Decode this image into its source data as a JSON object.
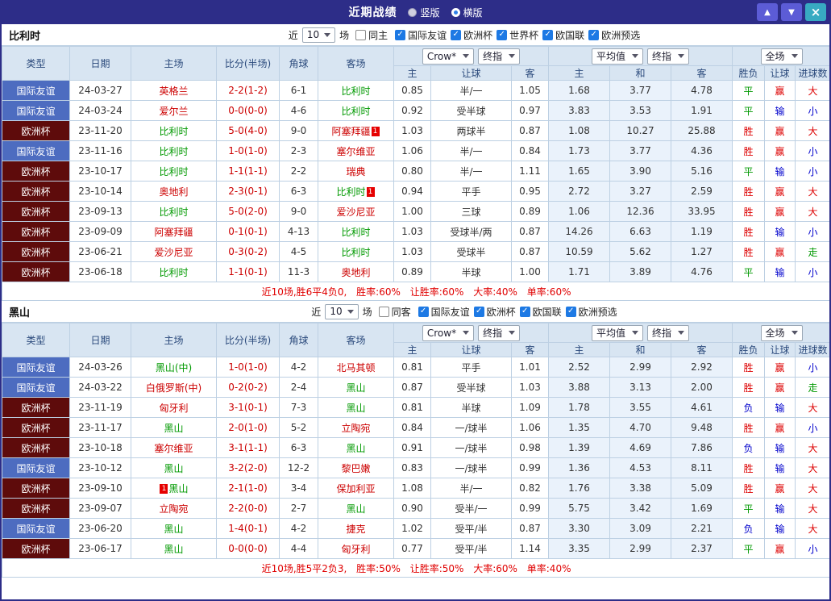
{
  "topbar": {
    "title": "近期战绩",
    "layout_options": [
      {
        "label": "竖版",
        "selected": false
      },
      {
        "label": "横版",
        "selected": true
      }
    ],
    "buttons": {
      "up": "▲",
      "down": "▼",
      "close": "×"
    }
  },
  "filter_common": {
    "near": "近",
    "count": "10",
    "matches": "场"
  },
  "table_header": {
    "static_cols": [
      "类型",
      "日期",
      "主场",
      "比分(半场)",
      "角球",
      "客场"
    ],
    "bookmaker_select": "Crow*",
    "stage_select": "终指",
    "average_select": "平均值",
    "avg_stage_select": "终指",
    "scope_select": "全场",
    "bookmaker_sub": [
      "主",
      "让球",
      "客"
    ],
    "average_sub": [
      "主",
      "和",
      "客"
    ],
    "result_sub": [
      "胜负",
      "让球",
      "进球数"
    ]
  },
  "colors": {
    "topbar_bg": "#2d2d88",
    "frame_border": "#2d2d88",
    "nav_btn_bg": "#5c5cd6",
    "close_btn_bg": "#38aac2",
    "header_bg": "#d8e5f2",
    "header_text": "#2b4a7c",
    "border": "#bdd0e3",
    "avg_col_bg": "#eaf2fb",
    "type_friendly_bg": "#4d6cc0",
    "type_euro_bg": "#5e0b0b",
    "subject_team": "#009900",
    "opponent_team": "#cc0000",
    "score_red": "#cc0000",
    "result_win": "#dd0000",
    "result_draw": "#009900",
    "result_lose": "#0000cc",
    "summary_red": "#e00000",
    "checkbox_blue": "#1d79e4",
    "radio_blue": "#2f7fe8"
  },
  "sections": [
    {
      "team": "比利时",
      "venue_filter": {
        "label": "同主",
        "checked": false
      },
      "competitions": [
        {
          "label": "国际友谊",
          "checked": true
        },
        {
          "label": "欧洲杯",
          "checked": true
        },
        {
          "label": "世界杯",
          "checked": true
        },
        {
          "label": "欧国联",
          "checked": true
        },
        {
          "label": "欧洲预选",
          "checked": true
        }
      ],
      "rows": [
        {
          "type": "国际友谊",
          "date": "24-03-27",
          "home": {
            "name": "英格兰",
            "subject": false
          },
          "score": "2-2(1-2)",
          "corners": "6-1",
          "away": {
            "name": "比利时",
            "subject": true
          },
          "odds": [
            "0.85",
            "半/一",
            "1.05"
          ],
          "avg": [
            "1.68",
            "3.77",
            "4.78"
          ],
          "results": [
            "平",
            "赢",
            "大"
          ]
        },
        {
          "type": "国际友谊",
          "date": "24-03-24",
          "home": {
            "name": "爱尔兰",
            "subject": false
          },
          "score": "0-0(0-0)",
          "corners": "4-6",
          "away": {
            "name": "比利时",
            "subject": true
          },
          "odds": [
            "0.92",
            "受半球",
            "0.97"
          ],
          "avg": [
            "3.83",
            "3.53",
            "1.91"
          ],
          "results": [
            "平",
            "输",
            "小"
          ]
        },
        {
          "type": "欧洲杯",
          "date": "23-11-20",
          "home": {
            "name": "比利时",
            "subject": true
          },
          "score": "5-0(4-0)",
          "corners": "9-0",
          "away": {
            "name": "阿塞拜疆",
            "subject": false,
            "card": "1",
            "card_pos": "after"
          },
          "odds": [
            "1.03",
            "两球半",
            "0.87"
          ],
          "avg": [
            "1.08",
            "10.27",
            "25.88"
          ],
          "results": [
            "胜",
            "赢",
            "大"
          ]
        },
        {
          "type": "国际友谊",
          "date": "23-11-16",
          "home": {
            "name": "比利时",
            "subject": true
          },
          "score": "1-0(1-0)",
          "corners": "2-3",
          "away": {
            "name": "塞尔维亚",
            "subject": false
          },
          "odds": [
            "1.06",
            "半/一",
            "0.84"
          ],
          "avg": [
            "1.73",
            "3.77",
            "4.36"
          ],
          "results": [
            "胜",
            "赢",
            "小"
          ]
        },
        {
          "type": "欧洲杯",
          "date": "23-10-17",
          "home": {
            "name": "比利时",
            "subject": true
          },
          "score": "1-1(1-1)",
          "corners": "2-2",
          "away": {
            "name": "瑞典",
            "subject": false
          },
          "odds": [
            "0.80",
            "半/一",
            "1.11"
          ],
          "avg": [
            "1.65",
            "3.90",
            "5.16"
          ],
          "results": [
            "平",
            "输",
            "小"
          ]
        },
        {
          "type": "欧洲杯",
          "date": "23-10-14",
          "home": {
            "name": "奥地利",
            "subject": false
          },
          "score": "2-3(0-1)",
          "corners": "6-3",
          "away": {
            "name": "比利时",
            "subject": true,
            "card": "1",
            "card_pos": "after"
          },
          "odds": [
            "0.94",
            "平手",
            "0.95"
          ],
          "avg": [
            "2.72",
            "3.27",
            "2.59"
          ],
          "results": [
            "胜",
            "赢",
            "大"
          ]
        },
        {
          "type": "欧洲杯",
          "date": "23-09-13",
          "home": {
            "name": "比利时",
            "subject": true
          },
          "score": "5-0(2-0)",
          "corners": "9-0",
          "away": {
            "name": "爱沙尼亚",
            "subject": false
          },
          "odds": [
            "1.00",
            "三球",
            "0.89"
          ],
          "avg": [
            "1.06",
            "12.36",
            "33.95"
          ],
          "results": [
            "胜",
            "赢",
            "大"
          ]
        },
        {
          "type": "欧洲杯",
          "date": "23-09-09",
          "home": {
            "name": "阿塞拜疆",
            "subject": false
          },
          "score": "0-1(0-1)",
          "corners": "4-13",
          "away": {
            "name": "比利时",
            "subject": true
          },
          "odds": [
            "1.03",
            "受球半/两",
            "0.87"
          ],
          "avg": [
            "14.26",
            "6.63",
            "1.19"
          ],
          "results": [
            "胜",
            "输",
            "小"
          ]
        },
        {
          "type": "欧洲杯",
          "date": "23-06-21",
          "home": {
            "name": "爱沙尼亚",
            "subject": false
          },
          "score": "0-3(0-2)",
          "corners": "4-5",
          "away": {
            "name": "比利时",
            "subject": true
          },
          "odds": [
            "1.03",
            "受球半",
            "0.87"
          ],
          "avg": [
            "10.59",
            "5.62",
            "1.27"
          ],
          "results": [
            "胜",
            "赢",
            "走"
          ]
        },
        {
          "type": "欧洲杯",
          "date": "23-06-18",
          "home": {
            "name": "比利时",
            "subject": true
          },
          "score": "1-1(0-1)",
          "corners": "11-3",
          "away": {
            "name": "奥地利",
            "subject": false
          },
          "odds": [
            "0.89",
            "半球",
            "1.00"
          ],
          "avg": [
            "1.71",
            "3.89",
            "4.76"
          ],
          "results": [
            "平",
            "输",
            "小"
          ]
        }
      ],
      "summary": "近10场,胜6平4负0, 胜率:60% 让胜率:60% 大率:40% 单率:60%"
    },
    {
      "team": "黑山",
      "venue_filter": {
        "label": "同客",
        "checked": false
      },
      "competitions": [
        {
          "label": "国际友谊",
          "checked": true
        },
        {
          "label": "欧洲杯",
          "checked": true
        },
        {
          "label": "欧国联",
          "checked": true
        },
        {
          "label": "欧洲预选",
          "checked": true
        }
      ],
      "rows": [
        {
          "type": "国际友谊",
          "date": "24-03-26",
          "home": {
            "name": "黑山(中)",
            "subject": true
          },
          "score": "1-0(1-0)",
          "corners": "4-2",
          "away": {
            "name": "北马其顿",
            "subject": false
          },
          "odds": [
            "0.81",
            "平手",
            "1.01"
          ],
          "avg": [
            "2.52",
            "2.99",
            "2.92"
          ],
          "results": [
            "胜",
            "赢",
            "小"
          ]
        },
        {
          "type": "国际友谊",
          "date": "24-03-22",
          "home": {
            "name": "白俄罗斯(中)",
            "subject": false
          },
          "score": "0-2(0-2)",
          "corners": "2-4",
          "away": {
            "name": "黑山",
            "subject": true
          },
          "odds": [
            "0.87",
            "受半球",
            "1.03"
          ],
          "avg": [
            "3.88",
            "3.13",
            "2.00"
          ],
          "results": [
            "胜",
            "赢",
            "走"
          ]
        },
        {
          "type": "欧洲杯",
          "date": "23-11-19",
          "home": {
            "name": "匈牙利",
            "subject": false
          },
          "score": "3-1(0-1)",
          "corners": "7-3",
          "away": {
            "name": "黑山",
            "subject": true
          },
          "odds": [
            "0.81",
            "半球",
            "1.09"
          ],
          "avg": [
            "1.78",
            "3.55",
            "4.61"
          ],
          "results": [
            "负",
            "输",
            "大"
          ]
        },
        {
          "type": "欧洲杯",
          "date": "23-11-17",
          "home": {
            "name": "黑山",
            "subject": true
          },
          "score": "2-0(1-0)",
          "corners": "5-2",
          "away": {
            "name": "立陶宛",
            "subject": false
          },
          "odds": [
            "0.84",
            "一/球半",
            "1.06"
          ],
          "avg": [
            "1.35",
            "4.70",
            "9.48"
          ],
          "results": [
            "胜",
            "赢",
            "小"
          ]
        },
        {
          "type": "欧洲杯",
          "date": "23-10-18",
          "home": {
            "name": "塞尔维亚",
            "subject": false
          },
          "score": "3-1(1-1)",
          "corners": "6-3",
          "away": {
            "name": "黑山",
            "subject": true
          },
          "odds": [
            "0.91",
            "一/球半",
            "0.98"
          ],
          "avg": [
            "1.39",
            "4.69",
            "7.86"
          ],
          "results": [
            "负",
            "输",
            "大"
          ]
        },
        {
          "type": "国际友谊",
          "date": "23-10-12",
          "home": {
            "name": "黑山",
            "subject": true
          },
          "score": "3-2(2-0)",
          "corners": "12-2",
          "away": {
            "name": "黎巴嫩",
            "subject": false
          },
          "odds": [
            "0.83",
            "一/球半",
            "0.99"
          ],
          "avg": [
            "1.36",
            "4.53",
            "8.11"
          ],
          "results": [
            "胜",
            "输",
            "大"
          ]
        },
        {
          "type": "欧洲杯",
          "date": "23-09-10",
          "home": {
            "name": "黑山",
            "subject": true,
            "card": "1",
            "card_pos": "before"
          },
          "score": "2-1(1-0)",
          "corners": "3-4",
          "away": {
            "name": "保加利亚",
            "subject": false
          },
          "odds": [
            "1.08",
            "半/一",
            "0.82"
          ],
          "avg": [
            "1.76",
            "3.38",
            "5.09"
          ],
          "results": [
            "胜",
            "赢",
            "大"
          ]
        },
        {
          "type": "欧洲杯",
          "date": "23-09-07",
          "home": {
            "name": "立陶宛",
            "subject": false
          },
          "score": "2-2(0-0)",
          "corners": "2-7",
          "away": {
            "name": "黑山",
            "subject": true
          },
          "odds": [
            "0.90",
            "受半/一",
            "0.99"
          ],
          "avg": [
            "5.75",
            "3.42",
            "1.69"
          ],
          "results": [
            "平",
            "输",
            "大"
          ]
        },
        {
          "type": "国际友谊",
          "date": "23-06-20",
          "home": {
            "name": "黑山",
            "subject": true
          },
          "score": "1-4(0-1)",
          "corners": "4-2",
          "away": {
            "name": "捷克",
            "subject": false
          },
          "odds": [
            "1.02",
            "受平/半",
            "0.87"
          ],
          "avg": [
            "3.30",
            "3.09",
            "2.21"
          ],
          "results": [
            "负",
            "输",
            "大"
          ]
        },
        {
          "type": "欧洲杯",
          "date": "23-06-17",
          "home": {
            "name": "黑山",
            "subject": true
          },
          "score": "0-0(0-0)",
          "corners": "4-4",
          "away": {
            "name": "匈牙利",
            "subject": false
          },
          "odds": [
            "0.77",
            "受平/半",
            "1.14"
          ],
          "avg": [
            "3.35",
            "2.99",
            "2.37"
          ],
          "results": [
            "平",
            "赢",
            "小"
          ]
        }
      ],
      "summary": "近10场,胜5平2负3, 胜率:50% 让胜率:50% 大率:60% 单率:40%"
    }
  ]
}
